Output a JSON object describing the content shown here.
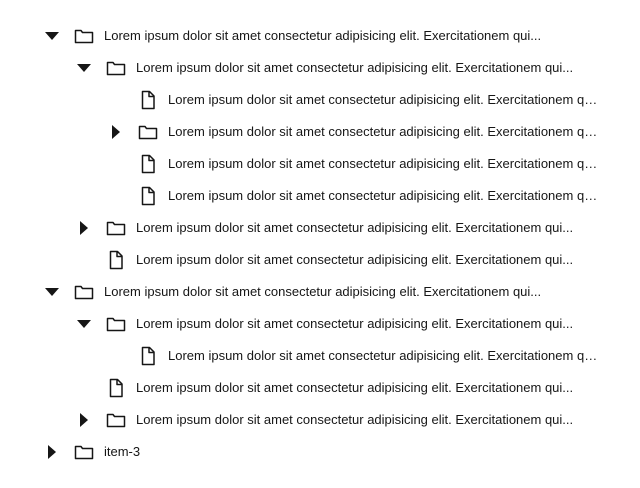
{
  "tree": {
    "nodes": [
      {
        "label": "Lorem ipsum dolor sit amet consectetur adipisicing elit. Exercitationem qui...",
        "type": "folder",
        "expanded": true
      },
      {
        "label": "Lorem ipsum dolor sit amet consectetur adipisicing elit. Exercitationem qui...",
        "type": "folder",
        "expanded": true
      },
      {
        "label": "Lorem ipsum dolor sit amet consectetur adipisicing elit. Exercitationem qui...",
        "type": "file"
      },
      {
        "label": "Lorem ipsum dolor sit amet consectetur adipisicing elit. Exercitationem qui...",
        "type": "folder",
        "expanded": false
      },
      {
        "label": "Lorem ipsum dolor sit amet consectetur adipisicing elit. Exercitationem qui...",
        "type": "file"
      },
      {
        "label": "Lorem ipsum dolor sit amet consectetur adipisicing elit. Exercitationem qui...",
        "type": "file"
      },
      {
        "label": "Lorem ipsum dolor sit amet consectetur adipisicing elit. Exercitationem qui...",
        "type": "folder",
        "expanded": false
      },
      {
        "label": "Lorem ipsum dolor sit amet consectetur adipisicing elit. Exercitationem qui...",
        "type": "file"
      },
      {
        "label": "Lorem ipsum dolor sit amet consectetur adipisicing elit. Exercitationem qui...",
        "type": "folder",
        "expanded": true
      },
      {
        "label": "Lorem ipsum dolor sit amet consectetur adipisicing elit. Exercitationem qui...",
        "type": "folder",
        "expanded": true
      },
      {
        "label": "Lorem ipsum dolor sit amet consectetur adipisicing elit. Exercitationem qui...",
        "type": "file"
      },
      {
        "label": "Lorem ipsum dolor sit amet consectetur adipisicing elit. Exercitationem qui...",
        "type": "file"
      },
      {
        "label": "Lorem ipsum dolor sit amet consectetur adipisicing elit. Exercitationem qui...",
        "type": "folder",
        "expanded": false
      },
      {
        "label": "item-3",
        "type": "folder",
        "expanded": false
      }
    ]
  }
}
